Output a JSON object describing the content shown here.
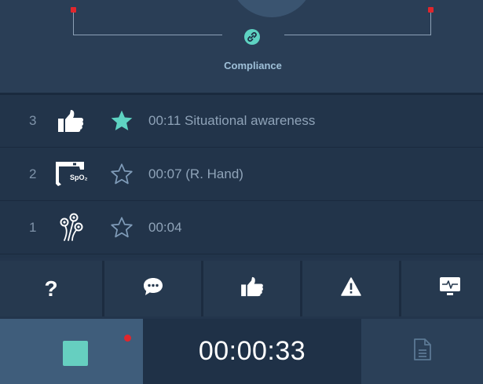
{
  "compliance": {
    "label": "Compliance",
    "icon": "link-icon",
    "marker_color": "#e0262c",
    "accent": "#5ed3c2"
  },
  "events": [
    {
      "number": "3",
      "action_icon": "thumbs-up-icon",
      "starred": true,
      "text": "00:11 Situational awareness"
    },
    {
      "number": "2",
      "action_icon": "spo2-sensor-icon",
      "starred": false,
      "text": "00:07 (R. Hand)"
    },
    {
      "number": "1",
      "action_icon": "electrodes-icon",
      "starred": false,
      "text": "00:04"
    }
  ],
  "spo2_label": "SpO₂",
  "toolbar": {
    "buttons": [
      {
        "name": "help",
        "icon": "question-icon",
        "glyph": "?"
      },
      {
        "name": "comment",
        "icon": "speech-bubble-icon"
      },
      {
        "name": "feedback",
        "icon": "thumbs-up-icon"
      },
      {
        "name": "warning",
        "icon": "warning-icon"
      },
      {
        "name": "monitor",
        "icon": "monitor-icon"
      }
    ]
  },
  "bottom": {
    "timer": "00:00:33",
    "stop_icon": "stop-icon",
    "recording_indicator_color": "#e0262c",
    "report_icon": "document-icon"
  }
}
